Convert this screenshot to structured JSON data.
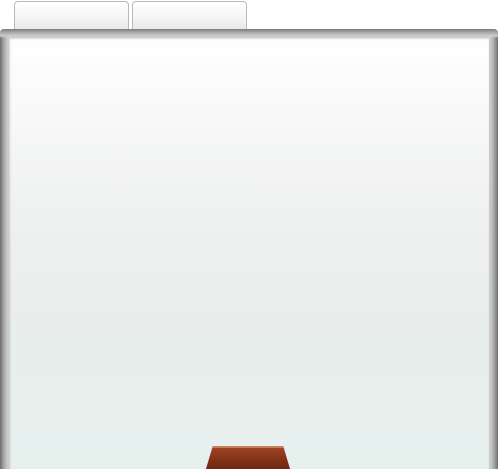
{
  "tabs": [
    {
      "label": ""
    },
    {
      "label": ""
    }
  ],
  "panel": {
    "content": ""
  },
  "colors": {
    "frame_dark": "#6e6e6e",
    "frame_light": "#c9c9c9",
    "panel_top": "#ffffff",
    "panel_bottom": "#e6f1ee",
    "handle": "#8a3618"
  },
  "icons": {
    "bottom_handle": "drawer-handle-icon"
  }
}
